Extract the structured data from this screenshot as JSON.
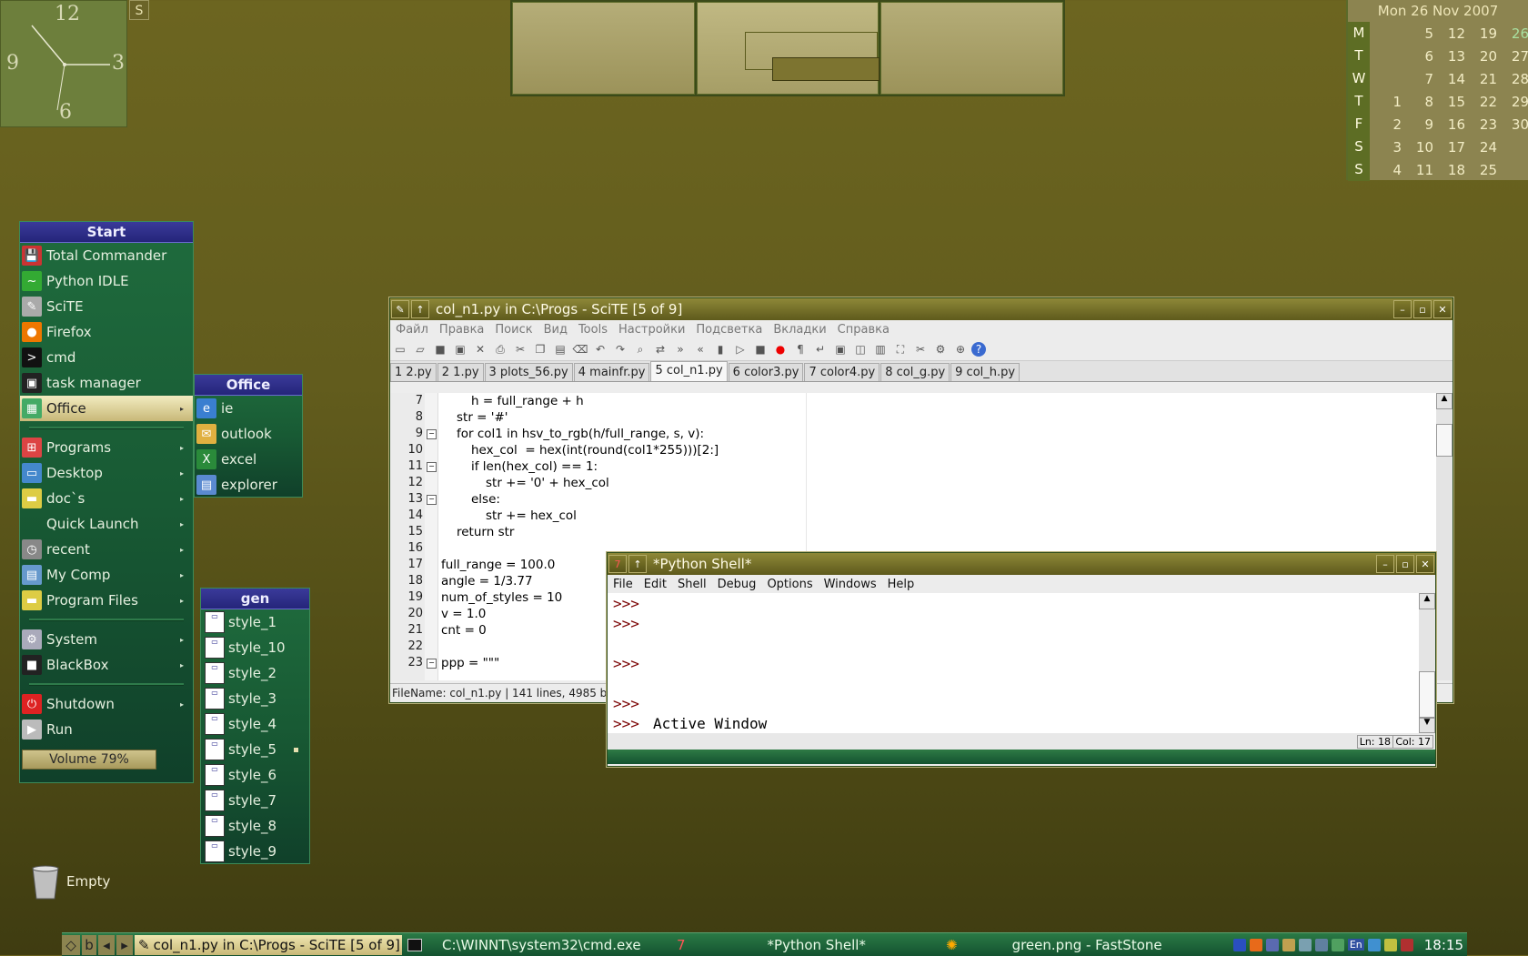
{
  "desktop": {
    "clock": {
      "numbers": [
        "12",
        "3",
        "6",
        "9"
      ]
    },
    "s_button": "S",
    "trash_label": "Empty"
  },
  "calendar": {
    "header": "Mon 26 Nov  2007",
    "day_names": [
      "M",
      "T",
      "W",
      "T",
      "F",
      "S",
      "S"
    ],
    "rows": [
      [
        "",
        "5",
        "12",
        "19",
        "26"
      ],
      [
        "",
        "6",
        "13",
        "20",
        "27"
      ],
      [
        "",
        "7",
        "14",
        "21",
        "28"
      ],
      [
        "1",
        "8",
        "15",
        "22",
        "29"
      ],
      [
        "2",
        "9",
        "16",
        "23",
        "30"
      ],
      [
        "3",
        "10",
        "17",
        "24",
        ""
      ],
      [
        "4",
        "11",
        "18",
        "25",
        ""
      ]
    ]
  },
  "start_menu": {
    "title": "Start",
    "items": [
      {
        "label": "Total Commander",
        "icon": "floppy-icon"
      },
      {
        "label": "Python IDLE",
        "icon": "python-icon"
      },
      {
        "label": "SciTE",
        "icon": "scite-icon"
      },
      {
        "label": "Firefox",
        "icon": "firefox-icon"
      },
      {
        "label": "cmd",
        "icon": "terminal-icon"
      },
      {
        "label": "task manager",
        "icon": "monitor-icon"
      },
      {
        "label": "Office",
        "icon": "office-icon"
      },
      {
        "label": "Programs",
        "icon": "windows-icon"
      },
      {
        "label": "Desktop",
        "icon": "desktop-icon"
      },
      {
        "label": "doc`s",
        "icon": "folder-icon"
      },
      {
        "label": "Quick Launch",
        "icon": ""
      },
      {
        "label": "recent",
        "icon": "clock-icon"
      },
      {
        "label": "My Comp",
        "icon": "computer-icon"
      },
      {
        "label": "Program Files",
        "icon": "folder-icon"
      },
      {
        "label": "System",
        "icon": "system-icon"
      },
      {
        "label": "BlackBox",
        "icon": "box-icon"
      },
      {
        "label": "Shutdown",
        "icon": "power-icon"
      },
      {
        "label": "Run",
        "icon": "run-icon"
      }
    ],
    "volume": "Volume 79%"
  },
  "office_menu": {
    "title": "Office",
    "items": [
      "ie",
      "outlook",
      "excel",
      "explorer"
    ]
  },
  "gen_menu": {
    "title": "gen",
    "items": [
      "style_1",
      "style_10",
      "style_2",
      "style_3",
      "style_4",
      "style_5",
      "style_6",
      "style_7",
      "style_8",
      "style_9"
    ]
  },
  "scite": {
    "title": "col_n1.py in C:\\Progs - SciTE [5 of 9]",
    "menu": [
      "Файл",
      "Правка",
      "Поиск",
      "Вид",
      "Tools",
      "Настройки",
      "Подсветка",
      "Вкладки",
      "Справка"
    ],
    "tabs": [
      "1 2.py",
      "2 1.py",
      "3 plots_56.py",
      "4 mainfr.py",
      "5 col_n1.py",
      "6 color3.py",
      "7 color4.py",
      "8 col_g.py",
      "9 col_h.py"
    ],
    "line_numbers": [
      "7",
      "8",
      "9",
      "10",
      "11",
      "12",
      "13",
      "14",
      "15",
      "16",
      "17",
      "18",
      "19",
      "20",
      "21",
      "22",
      "23"
    ],
    "code": [
      "h = full_range + h",
      "str = '#'",
      "for col1 in hsv_to_rgb(h/full_range, s, v):",
      "hex_col  = hex(int(round(col1*255)))[2:]",
      "if len(hex_col) == 1:",
      "str += '0' + hex_col",
      "else:",
      "str += hex_col",
      "return str",
      "",
      "full_range = 100.0",
      "angle = 1/3.77",
      "num_of_styles = 10",
      "v = 1.0",
      "cnt = 0",
      "",
      "ppp = \"\"\""
    ],
    "status": "FileName: col_n1.py  |  141 lines, 4985 by"
  },
  "shell": {
    "title": "*Python Shell*",
    "menu": [
      "File",
      "Edit",
      "Shell",
      "Debug",
      "Options",
      "Windows",
      "Help"
    ],
    "prompts": [
      ">>>",
      ">>>",
      ">>>",
      ">>>",
      ">>>"
    ],
    "last_text": "Active Window",
    "ln": "Ln: 18",
    "col": "Col: 17"
  },
  "taskbar": {
    "mini_buttons": [
      "◇",
      "b",
      "◂",
      "▸"
    ],
    "tasks": [
      "col_n1.py in C:\\Progs - SciTE [5 of 9]",
      "C:\\WINNT\\system32\\cmd.exe",
      "*Python Shell*",
      "green.png - FastStone"
    ],
    "lang": "En",
    "time": "18:15"
  }
}
